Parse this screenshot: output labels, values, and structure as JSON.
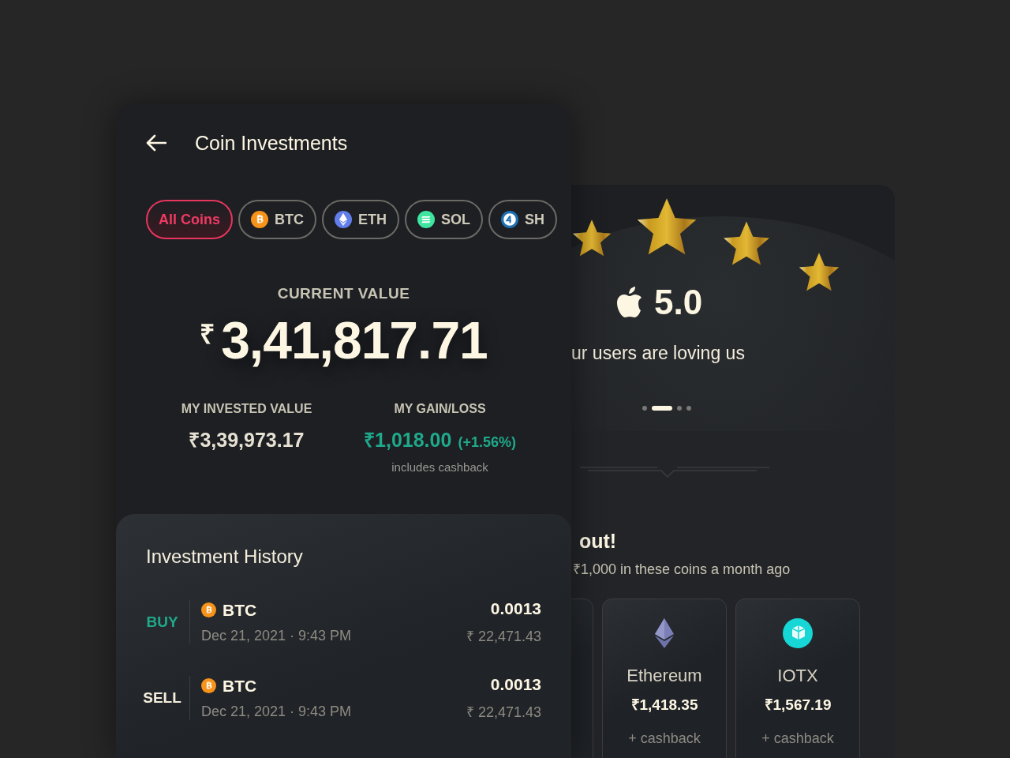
{
  "investments_screen": {
    "title": "Coin Investments",
    "filters": [
      {
        "label": "All Coins",
        "selected": true,
        "kind": "all"
      },
      {
        "label": "BTC",
        "selected": false,
        "kind": "btc"
      },
      {
        "label": "ETH",
        "selected": false,
        "kind": "eth"
      },
      {
        "label": "SOL",
        "selected": false,
        "kind": "sol"
      },
      {
        "label": "SH",
        "selected": false,
        "kind": "shib"
      }
    ],
    "current_value": {
      "label": "CURRENT VALUE",
      "currency": "₹",
      "amount": "3,41,817.71"
    },
    "invested": {
      "label": "MY INVESTED VALUE",
      "value": "₹3,39,973.17"
    },
    "gain": {
      "label": "MY GAIN/LOSS",
      "value": "₹1,018.00",
      "percent": "(+1.56%)",
      "note": "includes cashback"
    },
    "history": {
      "title": "Investment History",
      "rows": [
        {
          "type": "BUY",
          "kind": "buy",
          "coin": "BTC",
          "date": "Dec 21, 2021 · 9:43 PM",
          "quantity": "0.0013",
          "amount": "₹ 22,471.43"
        },
        {
          "type": "SELL",
          "kind": "sell",
          "coin": "BTC",
          "date": "Dec 21, 2021 · 9:43 PM",
          "quantity": "0.0013",
          "amount": "₹ 22,471.43"
        }
      ]
    }
  },
  "promo_screen": {
    "rating": {
      "score": "5.0",
      "caption": "ur users are loving us"
    },
    "pages": [
      {
        "selected": false
      },
      {
        "selected": true
      },
      {
        "selected": false
      },
      {
        "selected": false
      }
    ],
    "heading": "out!",
    "subtitle": "₹1,000 in these coins a month ago",
    "coins": [
      {
        "kind": "eth",
        "name": "Ethereum",
        "value": "₹1,418.35",
        "note": "+ cashback"
      },
      {
        "kind": "iotx",
        "name": "IOTX",
        "value": "₹1,567.19",
        "note": "+ cashback"
      }
    ]
  }
}
